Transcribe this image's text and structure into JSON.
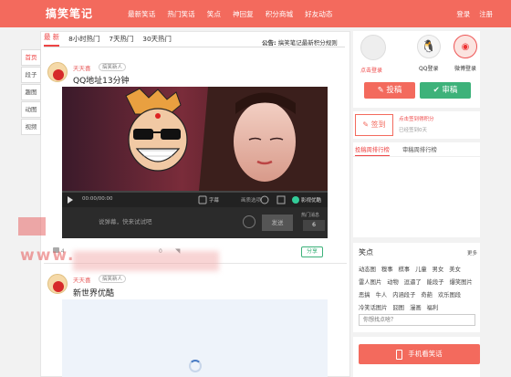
{
  "header": {
    "logo": "搞笑笔记",
    "nav": [
      "最新笑话",
      "热门笑话",
      "笑点",
      "神回复",
      "积分商城",
      "好友动态"
    ],
    "login": "登录",
    "register": "注册"
  },
  "tabs": [
    "最 新",
    "8小时热门",
    "7天热门",
    "30天热门"
  ],
  "notice": {
    "label": "公告:",
    "text": "搞笑笔记最新积分规则"
  },
  "sidenav": [
    "首页",
    "段子",
    "趣图",
    "动图",
    "视频"
  ],
  "post1": {
    "user": "天天喜",
    "badge": "搞笑新人",
    "title": "QQ地址13分钟",
    "video": {
      "time": "00:00/00:00",
      "subtitle_btn": "字幕",
      "tools": "画质选项",
      "brand": "影视优酷",
      "comment_placeholder": "说弹幕，快来试试吧",
      "send": "发送",
      "hot_label": "热门消息",
      "hot_count": "6"
    },
    "share_count": "0",
    "like_count": "4",
    "comment_count": "0",
    "share_btn": "分享"
  },
  "post2": {
    "user": "天天喜",
    "badge": "搞笑新人",
    "title": "新世界优酷"
  },
  "login_panel": {
    "avatar_caption": "点击登录",
    "qq": "QQ登录",
    "weibo": "微博登录",
    "contribute": "投稿",
    "review": "审稿"
  },
  "checkin": {
    "label": "签到",
    "line1": "点击签到得积分",
    "line2": "已经签到0天"
  },
  "rank_tabs": [
    "投稿周排行榜",
    "审稿周排行榜"
  ],
  "tags": {
    "title": "笑点",
    "more": "更多",
    "items": [
      "动态图",
      "糗事",
      "棋事",
      "儿童",
      "男女",
      "美女",
      "雷人图片",
      "动物",
      "逗逼了",
      "能段子",
      "爆笑图片",
      "恶搞",
      "牛人",
      "内涵段子",
      "奇葩",
      "欢乐图段",
      "冷笑话图片",
      "囧图",
      "漫画",
      "福利"
    ]
  },
  "search": {
    "placeholder": "你想找点啥？"
  },
  "mobile_btn": "手机看笑话",
  "watermark": "www.",
  "colors": {
    "accent": "#f36a5d",
    "green": "#3db27a"
  }
}
